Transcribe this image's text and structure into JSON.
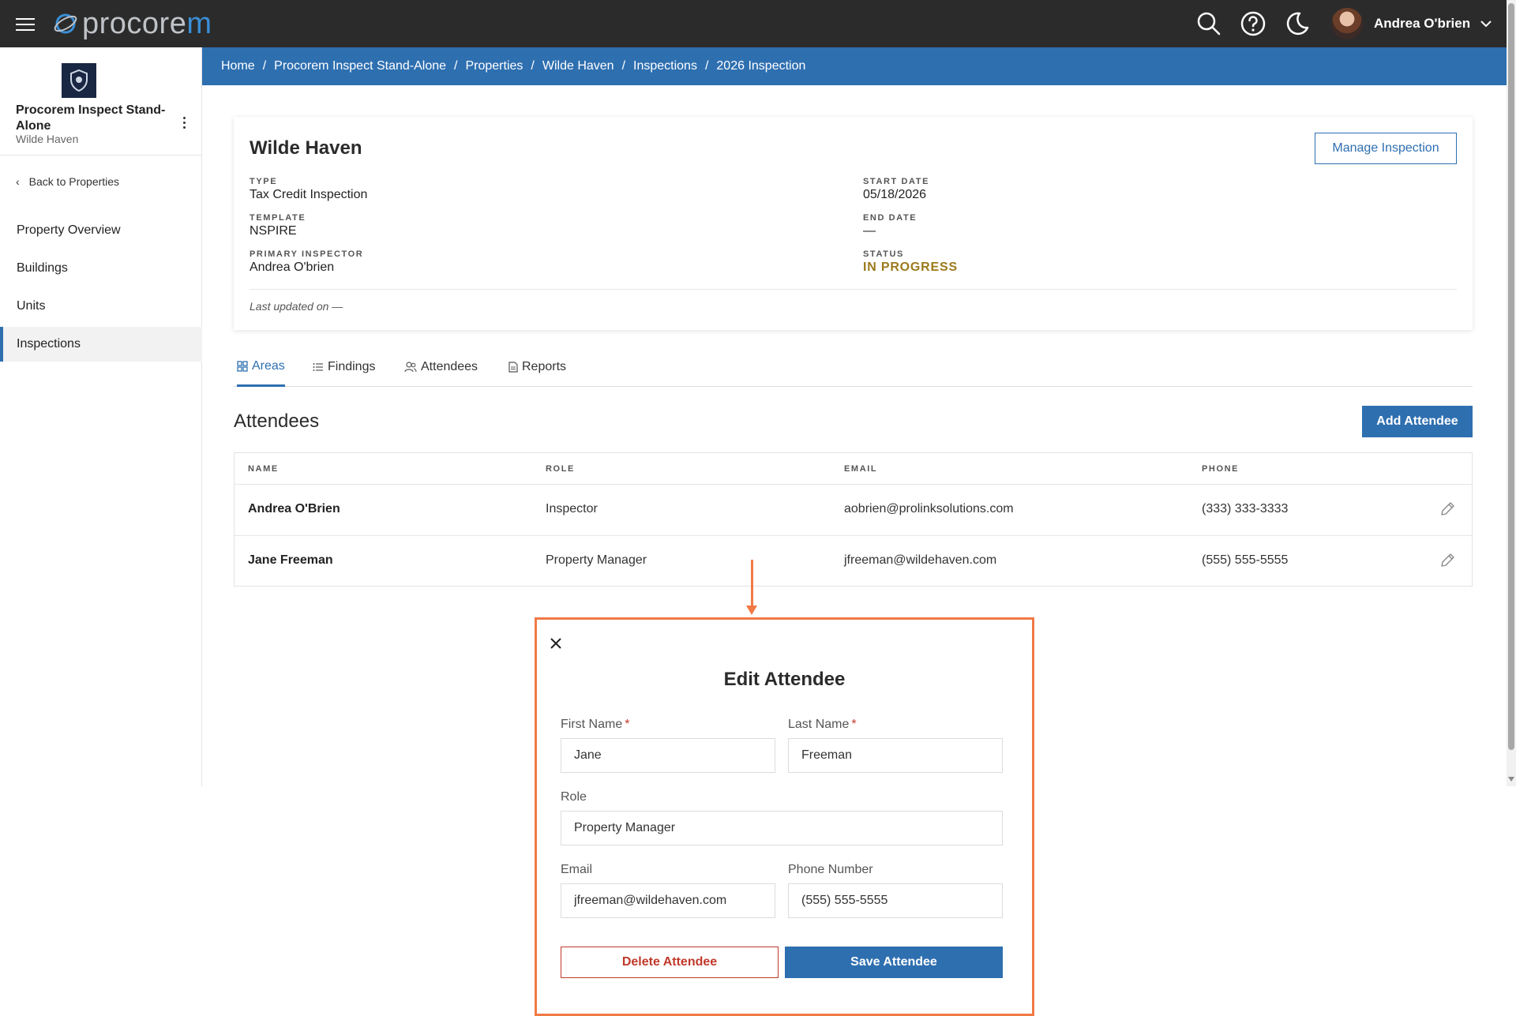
{
  "app": {
    "logo_prefix": "procore",
    "logo_suffix": "m",
    "user_name": "Andrea O'brien"
  },
  "sidebar": {
    "property_name": "Procorem Inspect Stand-Alone",
    "property_sub": "Wilde Haven",
    "back_label": "Back to Properties",
    "items": [
      {
        "label": "Property Overview"
      },
      {
        "label": "Buildings"
      },
      {
        "label": "Units"
      },
      {
        "label": "Inspections"
      }
    ]
  },
  "breadcrumb": [
    "Home",
    "Procorem Inspect Stand-Alone",
    "Properties",
    "Wilde Haven",
    "Inspections",
    "2026 Inspection"
  ],
  "inspection": {
    "title": "Wilde Haven",
    "manage_label": "Manage Inspection",
    "type_label": "TYPE",
    "type_value": "Tax Credit Inspection",
    "template_label": "TEMPLATE",
    "template_value": "NSPIRE",
    "inspector_label": "PRIMARY INSPECTOR",
    "inspector_value": "Andrea O'brien",
    "start_label": "START DATE",
    "start_value": "05/18/2026",
    "end_label": "END DATE",
    "end_value": "—",
    "status_label": "STATUS",
    "status_value": "IN PROGRESS",
    "last_updated": "Last updated on —"
  },
  "tabs": [
    {
      "label": "Areas"
    },
    {
      "label": "Findings"
    },
    {
      "label": "Attendees"
    },
    {
      "label": "Reports"
    }
  ],
  "attendees": {
    "title": "Attendees",
    "add_label": "Add Attendee",
    "columns": [
      "NAME",
      "ROLE",
      "EMAIL",
      "PHONE"
    ],
    "rows": [
      {
        "name": "Andrea O'Brien",
        "role": "Inspector",
        "email": "aobrien@prolinksolutions.com",
        "phone": "(333) 333-3333"
      },
      {
        "name": "Jane Freeman",
        "role": "Property Manager",
        "email": "jfreeman@wildehaven.com",
        "phone": "(555) 555-5555"
      }
    ]
  },
  "modal": {
    "title": "Edit Attendee",
    "first_name_label": "First Name",
    "first_name_value": "Jane",
    "last_name_label": "Last Name",
    "last_name_value": "Freeman",
    "role_label": "Role",
    "role_value": "Property Manager",
    "email_label": "Email",
    "email_value": "jfreeman@wildehaven.com",
    "phone_label": "Phone Number",
    "phone_value": "(555) 555-5555",
    "required_mark": "*",
    "delete_label": "Delete Attendee",
    "save_label": "Save Attendee"
  },
  "colors": {
    "topbar": "#2b2b2b",
    "primary": "#2e6fb0",
    "status": "#9c7a1c",
    "danger": "#c0392b",
    "annotation": "#f07a45"
  }
}
